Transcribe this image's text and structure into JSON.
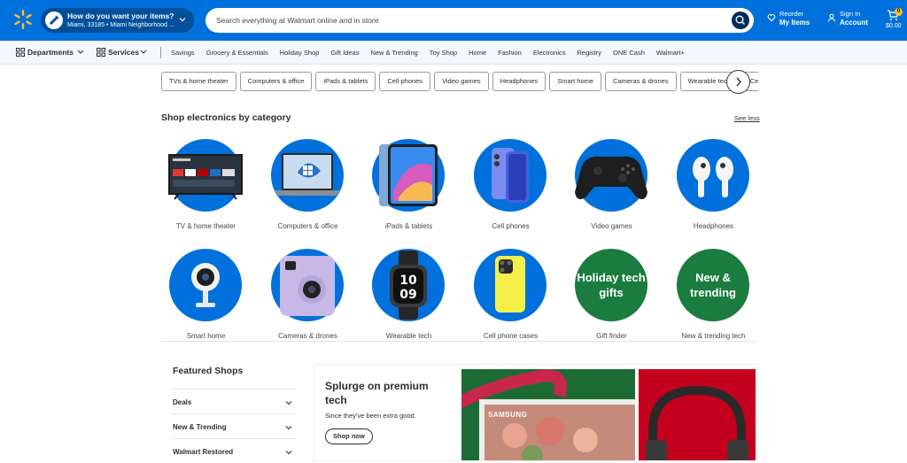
{
  "header": {
    "delivery_title": "How do you want your items?",
    "delivery_location": "Miami, 33185 • Miami Neighborhood ...",
    "search_placeholder": "Search everything at Walmart online and in store",
    "reorder_top": "Reorder",
    "reorder_bottom": "My Items",
    "signin_top": "Sign In",
    "signin_bottom": "Account",
    "cart_count": "0",
    "cart_total": "$0.00"
  },
  "nav": {
    "departments": "Departments",
    "services": "Services",
    "links": [
      "Savings",
      "Grocery & Essentials",
      "Holiday Shop",
      "Gift Ideas",
      "New & Trending",
      "Toy Shop",
      "Home",
      "Fashion",
      "Electronics",
      "Registry",
      "ONE Cash",
      "Walmart+"
    ]
  },
  "chips": [
    "TVs & home theater",
    "Computers & office",
    "iPads & tablets",
    "Cell phones",
    "Video games",
    "Headphones",
    "Smart home",
    "Cameras & drones",
    "Wearable tech",
    "Cell p"
  ],
  "categories_section": {
    "title": "Shop electronics by category",
    "see_less": "See less",
    "items": [
      {
        "label": "TV & home theater",
        "icon": "tv-icon"
      },
      {
        "label": "Computers & office",
        "icon": "laptop-icon"
      },
      {
        "label": "iPads & tablets",
        "icon": "tablet-icon"
      },
      {
        "label": "Cell phones",
        "icon": "phone-icon"
      },
      {
        "label": "Video games",
        "icon": "controller-icon"
      },
      {
        "label": "Headphones",
        "icon": "earbuds-icon"
      },
      {
        "label": "Smart home",
        "icon": "camera-icon"
      },
      {
        "label": "Cameras & drones",
        "icon": "instant-camera-icon"
      },
      {
        "label": "Wearable tech",
        "icon": "smartwatch-icon"
      },
      {
        "label": "Cell phone cases",
        "icon": "phone-case-icon"
      },
      {
        "label": "Gift finder",
        "text": "Holiday tech gifts"
      },
      {
        "label": "New & trending tech",
        "text": "New & trending"
      }
    ]
  },
  "featured": {
    "title": "Featured Shops",
    "items": [
      "Deals",
      "New & Trending",
      "Walmart Restored"
    ]
  },
  "promo": {
    "title": "Splurge on premium tech",
    "subtitle": "Since they've been extra good.",
    "button": "Shop now",
    "brand": "SAMSUNG"
  },
  "colors": {
    "brand_blue": "#0071dc",
    "dark_blue": "#004f9a",
    "spark_yellow": "#ffc220",
    "green": "#1a7c3e"
  }
}
